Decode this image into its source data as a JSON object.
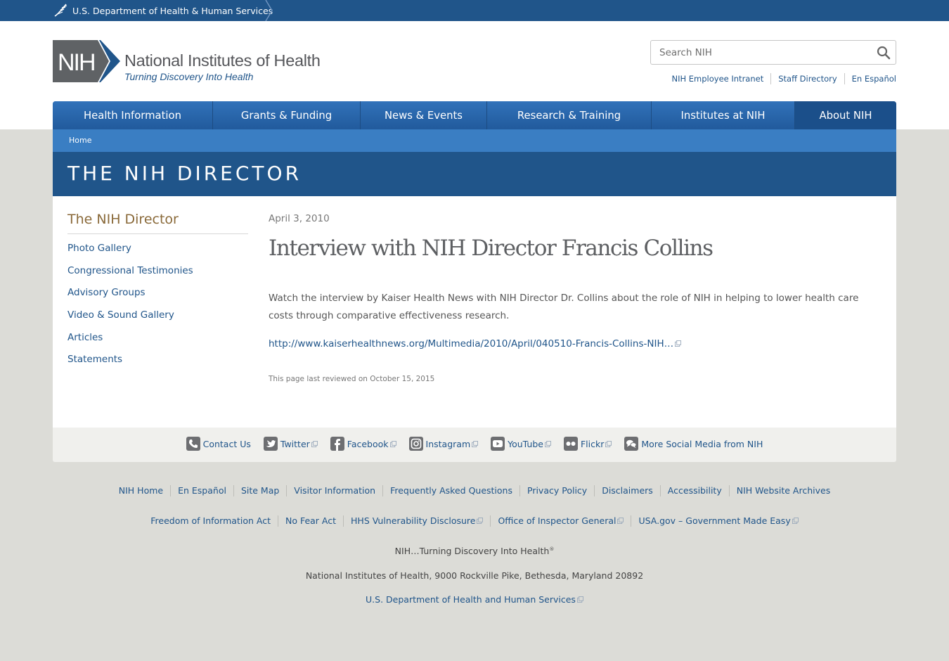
{
  "hhs_bar": {
    "label": "U.S. Department of Health & Human Services"
  },
  "header": {
    "logo_mark": "NIH",
    "logo_title": "National Institutes of Health",
    "logo_tagline": "Turning Discovery Into Health",
    "search_placeholder": "Search NIH",
    "util_links": [
      "NIH Employee Intranet",
      "Staff Directory",
      "En Español"
    ]
  },
  "nav": {
    "items": [
      "Health Information",
      "Grants & Funding",
      "News & Events",
      "Research & Training",
      "Institutes at NIH",
      "About NIH"
    ],
    "active": "About NIH"
  },
  "breadcrumb": {
    "home": "Home"
  },
  "banner_title": "THE NIH DIRECTOR",
  "sidebar": {
    "title": "The NIH Director",
    "items": [
      "Photo Gallery",
      "Congressional Testimonies",
      "Advisory Groups",
      "Video & Sound Gallery",
      "Articles",
      "Statements"
    ]
  },
  "article": {
    "date": "April 3, 2010",
    "title": "Interview with NIH Director Francis Collins",
    "body": "Watch the interview by Kaiser Health News with NIH Director Dr. Collins about the role of NIH in helping to lower health care costs through comparative effectiveness research.",
    "link": "http://www.kaiserhealthnews.org/Multimedia/2010/April/040510-Francis-Collins-NIH…",
    "reviewed": "This page last reviewed on October 15, 2015"
  },
  "social": {
    "contact": "Contact Us",
    "twitter": "Twitter",
    "facebook": "Facebook",
    "instagram": "Instagram",
    "youtube": "YouTube",
    "flickr": "Flickr",
    "more": "More Social Media from NIH"
  },
  "footer": {
    "row1": [
      "NIH Home",
      "En Español",
      "Site Map",
      "Visitor Information",
      "Frequently Asked Questions",
      "Privacy Policy",
      "Disclaimers",
      "Accessibility",
      "NIH Website Archives"
    ],
    "row2": [
      "Freedom of Information Act",
      "No Fear Act",
      "HHS Vulnerability Disclosure",
      "Office of Inspector General",
      "USA.gov – Government Made Easy"
    ],
    "tagline": "NIH…Turning Discovery Into Health",
    "tagline_mark": "®",
    "address": "National Institutes of Health, 9000 Rockville Pike, Bethesda, Maryland 20892",
    "hhs_link": "U.S. Department of Health and Human Services"
  },
  "colors": {
    "brand_blue": "#20558a",
    "nav_blue": "#2d6ab0",
    "crumb_blue": "#3a7ec3",
    "sidebar_title_brown": "#8a6a3a"
  },
  "icons": [
    "hhs-eagle-icon",
    "search-icon",
    "phone-icon",
    "twitter-icon",
    "facebook-icon",
    "instagram-icon",
    "youtube-icon",
    "flickr-icon",
    "chat-icon",
    "external-link-icon"
  ]
}
